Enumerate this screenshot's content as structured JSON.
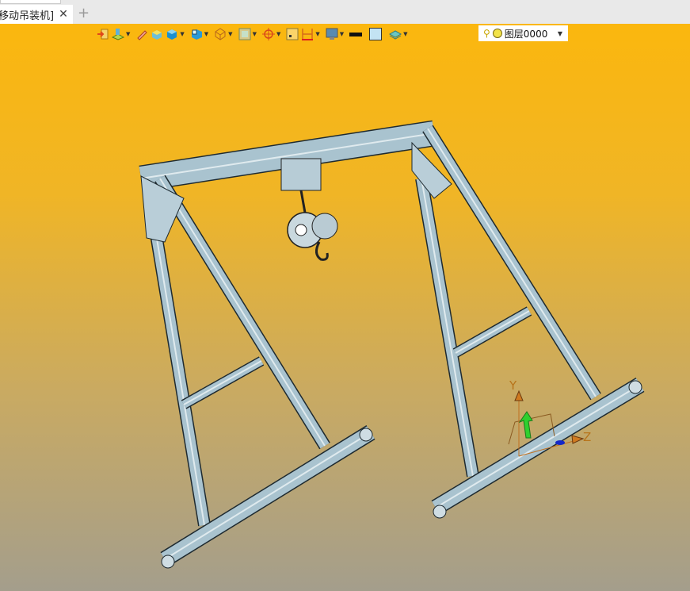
{
  "tab": {
    "label": "移动吊装机]",
    "close": "✕",
    "add": "+"
  },
  "toolbar": {
    "icons": [
      "exit-icon",
      "sketch-plane-icon",
      "pencil-icon",
      "box-solid-icon",
      "shaded-cube-icon",
      "view-cube-icon",
      "wireframe-icon",
      "render-mode-icon",
      "target-icon",
      "snap-icon",
      "dimension-icon",
      "display-icon",
      "line-color-icon",
      "fill-color-icon",
      "layer-stack-icon"
    ],
    "line_color": "#111111",
    "fill_color": "#c3e3f3"
  },
  "layer": {
    "name": "图层0000",
    "bulb": "💡"
  },
  "triad": {
    "y": "Y",
    "z": "Z"
  },
  "colors": {
    "viewport_top": "#fbb70e",
    "viewport_bottom": "#a49e8c",
    "steel": "#a9c3cf"
  }
}
